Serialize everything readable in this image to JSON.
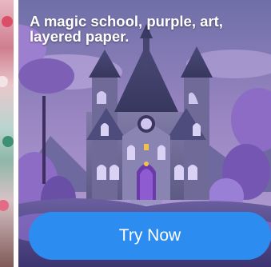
{
  "ad": {
    "caption": "A magic school, purple, art, layered paper.",
    "cta_label": "Try Now",
    "cta_color": "#2d8cf0",
    "scene_icon": "castle-illustration"
  }
}
